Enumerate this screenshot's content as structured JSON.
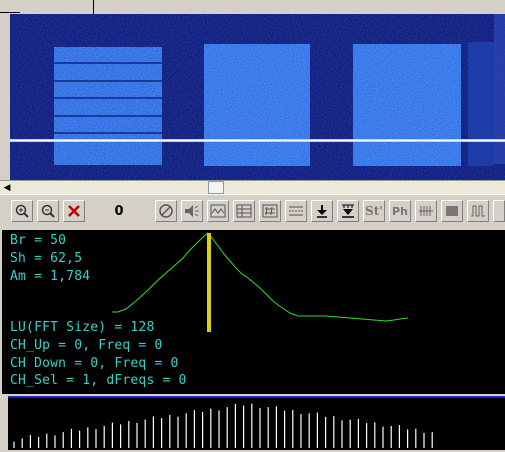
{
  "toolbar": {
    "zoom_value": "0",
    "buttons": [
      {
        "name": "zoom-in-icon",
        "glyph": "⊕"
      },
      {
        "name": "zoom-out-icon",
        "glyph": "⊖"
      },
      {
        "name": "close-icon",
        "glyph": "✕"
      },
      {
        "name": "stop-icon",
        "glyph": "⊘"
      },
      {
        "name": "speaker-icon",
        "glyph": "◖"
      },
      {
        "name": "waveform-settings-icon",
        "glyph": "▦"
      },
      {
        "name": "grid-settings-icon",
        "glyph": "▤"
      },
      {
        "name": "filter-icon",
        "glyph": "☰"
      },
      {
        "name": "down-arrow-icon",
        "glyph": "▼"
      },
      {
        "name": "marker-icon",
        "glyph": "▼"
      },
      {
        "name": "st-label",
        "glyph": "St"
      },
      {
        "name": "ph-label",
        "glyph": "Ph"
      },
      {
        "name": "comb-icon",
        "glyph": "┃┃"
      },
      {
        "name": "fill-icon",
        "glyph": "■"
      },
      {
        "name": "pulse-icon",
        "glyph": "⊓"
      }
    ]
  },
  "stats": {
    "br": "Br = 50",
    "sh": "Sh = 62,5",
    "am": "Am = 1,784",
    "lu": "LU(FFT Size) = 128",
    "ch_up": "CH_Up = 0, Freq = 0",
    "ch_down": "CH Down = 0, Freq = 0",
    "ch_sel": "CH_Sel = 1, dFreqs = 0"
  },
  "colors": {
    "scope_trace": "#33dd33",
    "scope_marker": "#d8d010",
    "stats_text": "#38d0c8",
    "waterfall_block": "#2f6fe8",
    "spectrum_bar": "#ffffff"
  }
}
